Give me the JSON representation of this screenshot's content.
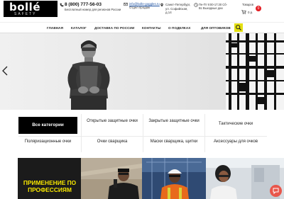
{
  "header": {
    "logo_text": "bollé",
    "logo_sub": "SAFETY",
    "phone": "8 (800) 777-56-03",
    "phone_note": "Бесплатный номер для регионов России",
    "email": "info@bolle-goggles.ru",
    "email_note": "Отдел продаж",
    "address": "Санкт-Петербург, ул. Софийская, д.14",
    "hours": "Пн-Пт 9:00-17:30 Сб-Вс Выходные дни",
    "cart_label": "Товаров",
    "cart_sum": "0 р.",
    "cart_count": "0"
  },
  "nav": {
    "items": [
      "ГЛАВНАЯ",
      "КАТАЛОГ",
      "ДОСТАВКА ПО РОССИИ",
      "КОНТАКТЫ",
      "О ПОДЕЛКАХ",
      "ДЛЯ ОПТОВИКОВ"
    ]
  },
  "categories": {
    "all": "Все категории",
    "open": "Открытые защитные очки",
    "closed": "Закрытые защитные очки",
    "tactical": "Тактические очки",
    "polarized": "Поляризационные очки",
    "welder": "Очки сварщика",
    "masks": "Маски сварщика, щитки",
    "accessories": "Аксессуары для очков"
  },
  "banner": {
    "text": "ПРИМЕНЕНИЕ ПО ПРОФЕССИЯМ"
  },
  "colors": {
    "accent": "#e4e012",
    "banner_text": "#f5e500",
    "badge": "#e31e24",
    "chat": "#e8564b"
  },
  "icons": [
    "phone-icon",
    "mail-icon",
    "location-icon",
    "clock-icon",
    "cart-icon",
    "search-icon",
    "chevron-left-icon",
    "chat-icon"
  ]
}
